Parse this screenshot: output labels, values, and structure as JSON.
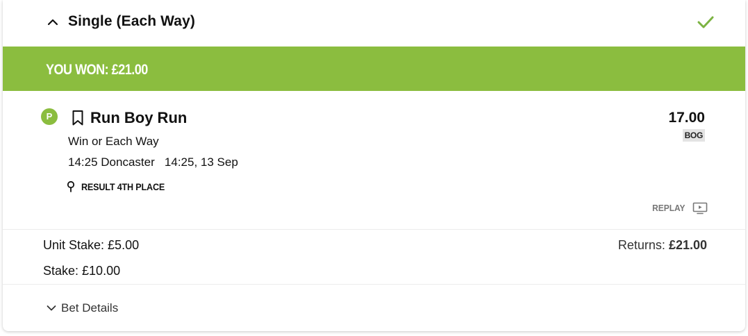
{
  "header": {
    "title": "Single (Each Way)",
    "collapse_icon": "chevron-up-icon",
    "status_icon": "checkmark-icon",
    "status_color": "#7cb342"
  },
  "banner": {
    "text": "YOU WON: £21.00",
    "color": "#8bbd3f"
  },
  "selection": {
    "badge": "P",
    "name": "Run Boy Run",
    "market": "Win or Each Way",
    "event": "14:25 Doncaster   14:25, 13 Sep",
    "result": "RESULT 4TH PLACE",
    "odds": "17.00",
    "odds_tag": "BOG",
    "replay_label": "REPLAY"
  },
  "stakes": {
    "unit_stake": "Unit Stake: £5.00",
    "stake": "Stake: £10.00",
    "returns_label": "Returns: ",
    "returns_value": "£21.00"
  },
  "footer": {
    "details_label": "Bet Details"
  }
}
